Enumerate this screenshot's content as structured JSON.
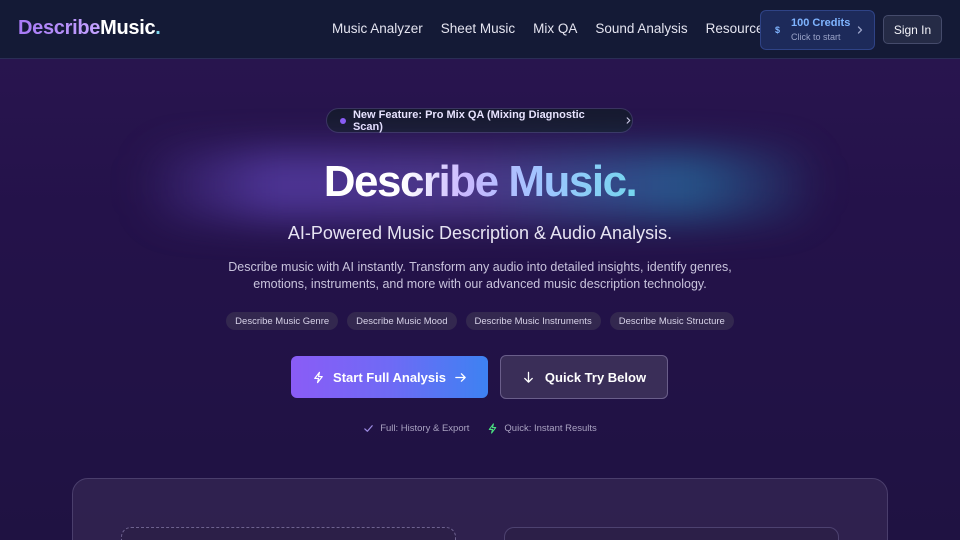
{
  "navbar": {
    "logo": {
      "part1": "Describe",
      "part2": "Music",
      "part3": "."
    },
    "links": [
      {
        "label": "Music Analyzer"
      },
      {
        "label": "Sheet Music"
      },
      {
        "label": "Mix QA"
      },
      {
        "label": "Sound Analysis"
      },
      {
        "label": "Resources"
      }
    ],
    "credits": {
      "currency_symbol": "$",
      "main": "100 Credits",
      "sub": "Click to start"
    },
    "signin_label": "Sign In"
  },
  "hero": {
    "feature_pill": "New Feature: Pro Mix QA (Mixing Diagnostic Scan)",
    "title": "Describe Music.",
    "subtitle": "AI-Powered Music Description & Audio Analysis.",
    "description": "Describe music with AI instantly. Transform any audio into detailed insights, identify genres, emotions, instruments, and more with our advanced music description technology.",
    "chips": [
      {
        "label": "Describe Music Genre"
      },
      {
        "label": "Describe Music Mood"
      },
      {
        "label": "Describe Music Instruments"
      },
      {
        "label": "Describe Music Structure"
      }
    ],
    "primary_button": "Start Full Analysis",
    "secondary_button": "Quick Try Below",
    "hints": [
      {
        "label": "Full: History & Export"
      },
      {
        "label": "Quick: Instant Results"
      }
    ]
  },
  "colors": {
    "accent_purple": "#8a5cf6",
    "accent_blue": "#3d82f2",
    "check_green": "#4ade80",
    "credits_blue": "#7fb4ff"
  }
}
